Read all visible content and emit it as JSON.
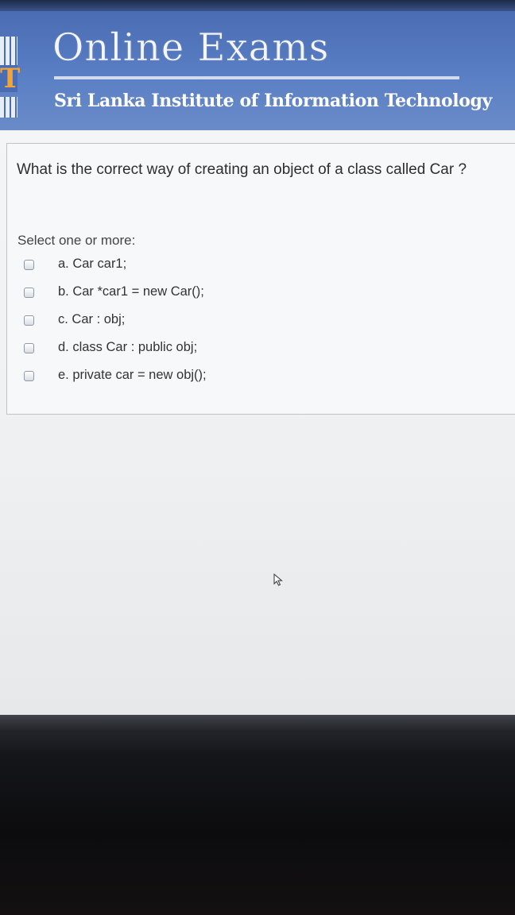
{
  "header": {
    "title": "Online Exams",
    "institute": "Sri Lanka Institute of Information Technology",
    "logo_letter": "T"
  },
  "question": {
    "text": "What is the correct way of creating an object of a class called Car ?",
    "select_label": "Select one or more:",
    "options": [
      {
        "label": "a. Car car1;",
        "checked": false
      },
      {
        "label": "b. Car *car1 = new Car();",
        "checked": false
      },
      {
        "label": "c. Car : obj;",
        "checked": false
      },
      {
        "label": "d. class Car : public obj;",
        "checked": false
      },
      {
        "label": "e. private car = new obj();",
        "checked": false
      }
    ]
  },
  "colors": {
    "header_blue": "#5a7fc4",
    "logo_orange": "#f0a43a",
    "page_background": "#f4f5f7"
  }
}
